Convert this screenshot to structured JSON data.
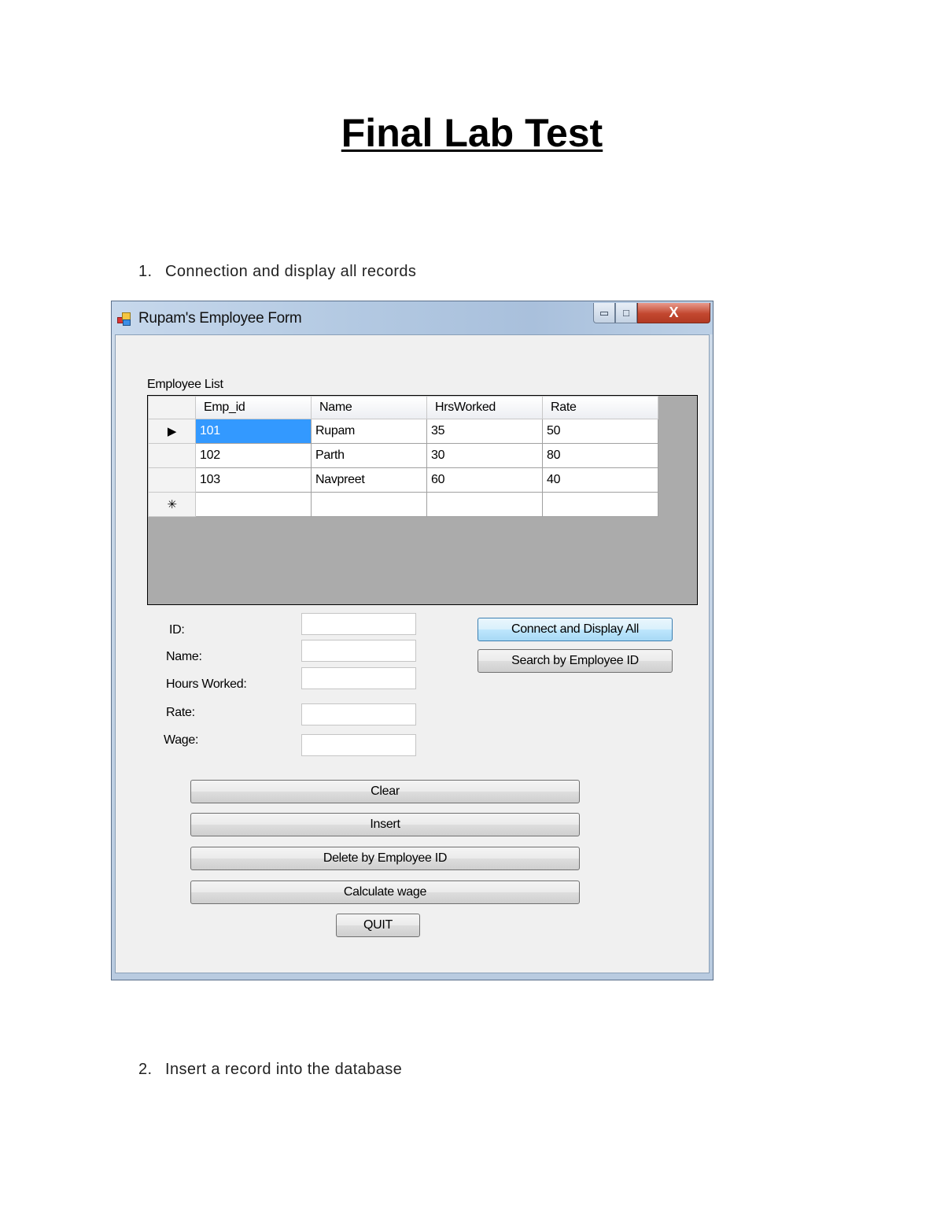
{
  "document": {
    "title": "Final Lab Test",
    "steps": [
      {
        "number": "1.",
        "text": "Connection and display all records"
      },
      {
        "number": "2.",
        "text": "Insert a record into the database"
      }
    ]
  },
  "window": {
    "title": "Rupam's Employee Form",
    "controls": {
      "minimize": "▭",
      "maximize": "□",
      "close": "X"
    }
  },
  "grid": {
    "label": "Employee List",
    "columns": [
      "Emp_id",
      "Name",
      "HrsWorked",
      "Rate"
    ],
    "rows": [
      {
        "marker": "▶",
        "cells": [
          "101",
          "Rupam",
          "35",
          "50"
        ]
      },
      {
        "marker": "",
        "cells": [
          "102",
          "Parth",
          "30",
          "80"
        ]
      },
      {
        "marker": "",
        "cells": [
          "103",
          "Navpreet",
          "60",
          "40"
        ]
      }
    ],
    "new_row_marker": "✳"
  },
  "form": {
    "labels": {
      "id": "ID:",
      "name": "Name:",
      "hours": "Hours Worked:",
      "rate": "Rate:",
      "wage": "Wage:"
    }
  },
  "buttons": {
    "connect": "Connect and Display All",
    "search": "Search by Employee ID",
    "clear": "Clear",
    "insert": "Insert",
    "delete": "Delete by Employee ID",
    "calculate": "Calculate wage",
    "quit": "QUIT"
  }
}
